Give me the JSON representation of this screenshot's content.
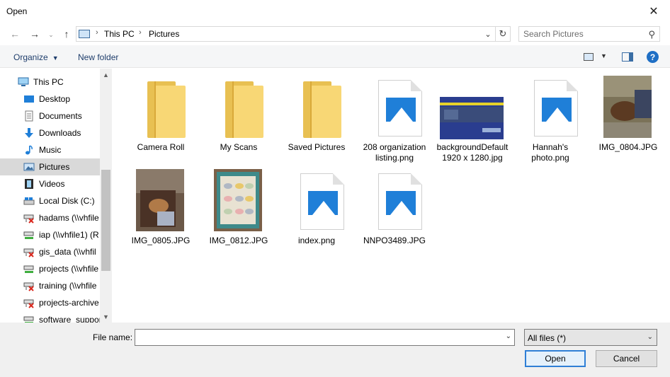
{
  "window": {
    "title": "Open"
  },
  "address": {
    "path": [
      "This PC",
      "Pictures"
    ]
  },
  "search": {
    "placeholder": "Search Pictures"
  },
  "toolbar": {
    "organize": "Organize",
    "new_folder": "New folder"
  },
  "sidebar": {
    "items": [
      {
        "label": "This PC",
        "icon": "computer-icon",
        "selected": false
      },
      {
        "label": "Desktop",
        "icon": "desktop-icon",
        "selected": false
      },
      {
        "label": "Documents",
        "icon": "documents-icon",
        "selected": false
      },
      {
        "label": "Downloads",
        "icon": "downloads-icon",
        "selected": false
      },
      {
        "label": "Music",
        "icon": "music-icon",
        "selected": false
      },
      {
        "label": "Pictures",
        "icon": "pictures-icon",
        "selected": true
      },
      {
        "label": "Videos",
        "icon": "videos-icon",
        "selected": false
      },
      {
        "label": "Local Disk (C:)",
        "icon": "drive-icon",
        "selected": false
      },
      {
        "label": "hadams (\\\\vhfile",
        "icon": "network-drive-disconnected-icon",
        "selected": false
      },
      {
        "label": "iap (\\\\vhfile1) (R",
        "icon": "network-drive-connected-icon",
        "selected": false
      },
      {
        "label": "gis_data (\\\\vhfil",
        "icon": "network-drive-disconnected-icon",
        "selected": false
      },
      {
        "label": "projects (\\\\vhfile",
        "icon": "network-drive-connected-icon",
        "selected": false
      },
      {
        "label": "training (\\\\vhfile",
        "icon": "network-drive-disconnected-icon",
        "selected": false
      },
      {
        "label": "projects-archive",
        "icon": "network-drive-disconnected-icon",
        "selected": false
      },
      {
        "label": "software_suppor",
        "icon": "network-drive-connected-icon",
        "selected": false
      }
    ]
  },
  "files": [
    {
      "name": "Camera Roll",
      "kind": "folder"
    },
    {
      "name": "My Scans",
      "kind": "folder"
    },
    {
      "name": "Saved Pictures",
      "kind": "folder"
    },
    {
      "name": "208 organization listing.png",
      "kind": "image-file"
    },
    {
      "name": "backgroundDefault1920 x 1280.jpg",
      "kind": "photo-background"
    },
    {
      "name": "Hannah's photo.png",
      "kind": "image-file"
    },
    {
      "name": "IMG_0804.JPG",
      "kind": "photo-dog-couch"
    },
    {
      "name": "IMG_0805.JPG",
      "kind": "photo-dog-chair"
    },
    {
      "name": "IMG_0812.JPG",
      "kind": "photo-quilt"
    },
    {
      "name": "index.png",
      "kind": "image-file"
    },
    {
      "name": "NNPO3489.JPG",
      "kind": "image-file"
    }
  ],
  "footer": {
    "file_name_label": "File name:",
    "file_name_value": "",
    "filter": "All files (*)",
    "open": "Open",
    "cancel": "Cancel"
  },
  "colors": {
    "accent": "#1f7fd8",
    "folder": "#f8d775",
    "selected": "#d9d9d9"
  }
}
